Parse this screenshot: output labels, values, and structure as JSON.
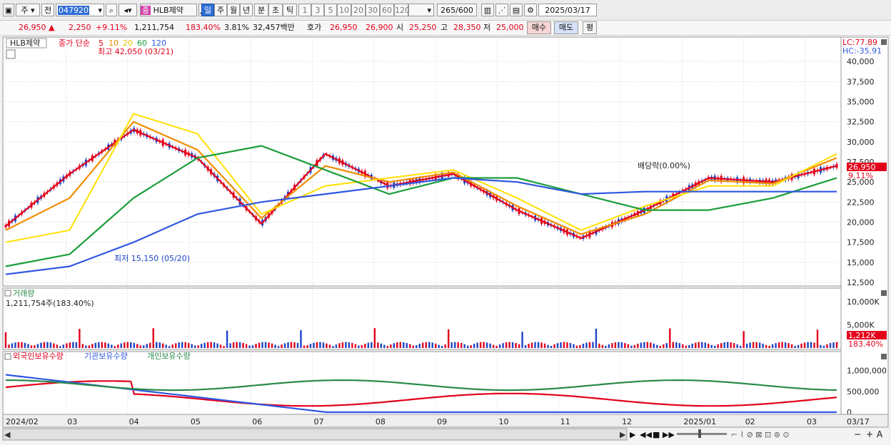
{
  "toolbar": {
    "type_label": "주",
    "prev_label": "전",
    "code": "047920",
    "stock_name_badge": "종",
    "stock_name": "HLB제약",
    "periods": [
      "일",
      "주",
      "월",
      "년",
      "분",
      "초",
      "틱"
    ],
    "active_period": "일",
    "intervals": [
      "1",
      "3",
      "5",
      "10",
      "20",
      "30",
      "60",
      "120"
    ],
    "count": "265",
    "count_total": "/600",
    "date": "2025/03/17"
  },
  "quote": {
    "price": "26,950",
    "change": "2,250",
    "change_pct": "+9.11%",
    "volume": "1,211,754",
    "volume_ratio": "183.40%",
    "turnover_pct": "3.81%",
    "amount": "32,457백만",
    "hoga_label": "호가",
    "hoga_ask": "26,950",
    "hoga_bid": "26,900",
    "open_label": "시",
    "open": "25,250",
    "high_label": "고",
    "high": "28,350",
    "low_label": "저",
    "low": "25,000",
    "buy_label": "매수",
    "sell_label": "매도",
    "avg_label": "평"
  },
  "price_panel": {
    "name_tag": "HLB제약",
    "legend_close": "종가 단순",
    "legend_periods": [
      "5",
      "10",
      "20",
      "60",
      "120"
    ],
    "legend_colors": [
      "#e3001b",
      "#f08c00",
      "#ffe000",
      "#1a9e3a",
      "#2f57e0"
    ],
    "lc": "LC:77.89",
    "hc": "HC:-35.91",
    "y_ticks": [
      "40,000",
      "37,500",
      "35,000",
      "32,500",
      "30,000",
      "27,500",
      "25,000",
      "22,500",
      "20,000",
      "17,500",
      "15,000",
      "12,500"
    ],
    "current_price_tag": "26,950",
    "current_pct_tag": "9.11%",
    "high_annotation": "최고 42,050 (03/21)",
    "low_annotation": "최저 15,150 (05/20)",
    "dividend_annotation": "배당락(0.00%)"
  },
  "volume_panel": {
    "title": "거래량",
    "value": "1,211,754주(183.40%)",
    "y_ticks": [
      "10,000K",
      "5,000K"
    ],
    "current_tag": "1,212K",
    "current_pct": "183.40%"
  },
  "holding_panel": {
    "legend": [
      "외국인보유수량",
      "기관보유수량",
      "개인보유수량"
    ],
    "legend_colors": [
      "#e3001b",
      "#2f57e0",
      "#2a8a4a"
    ],
    "y_ticks": [
      "1,000,000",
      "500,000",
      "0"
    ]
  },
  "x_axis": {
    "labels": [
      "2024/02",
      "03",
      "04",
      "05",
      "06",
      "07",
      "08",
      "09",
      "10",
      "11",
      "12",
      "2025/01",
      "02",
      "03",
      "03/17"
    ]
  },
  "chart_data": {
    "type": "candlestick",
    "x": [
      "2024-02",
      "2024-03",
      "2024-04",
      "2024-05",
      "2024-06",
      "2024-07",
      "2024-08",
      "2024-09",
      "2024-10",
      "2024-11",
      "2024-12",
      "2025-01",
      "2025-02",
      "2025-03"
    ],
    "series": [
      {
        "name": "5",
        "values": [
          19500,
          26000,
          31500,
          28000,
          19800,
          28500,
          24500,
          26000,
          21500,
          18000,
          21500,
          25500,
          25000,
          27000
        ]
      },
      {
        "name": "10",
        "values": [
          19000,
          23000,
          32500,
          29000,
          20500,
          27000,
          25000,
          26200,
          22000,
          18500,
          21000,
          25200,
          24800,
          28000
        ]
      },
      {
        "name": "20",
        "values": [
          17500,
          19000,
          33500,
          31000,
          21000,
          24500,
          25500,
          26500,
          23000,
          19000,
          22000,
          24500,
          24500,
          28500
        ]
      },
      {
        "name": "60",
        "values": [
          14500,
          16000,
          23000,
          28000,
          29500,
          26500,
          23500,
          25500,
          25500,
          23500,
          21500,
          21500,
          23000,
          25500
        ]
      },
      {
        "name": "120",
        "values": [
          13500,
          14500,
          17500,
          21000,
          22500,
          23500,
          24500,
          25500,
          25000,
          23500,
          23800,
          23800,
          23800,
          23800
        ]
      }
    ],
    "volume_current": 1211754,
    "ylim": [
      12500,
      42500
    ]
  }
}
